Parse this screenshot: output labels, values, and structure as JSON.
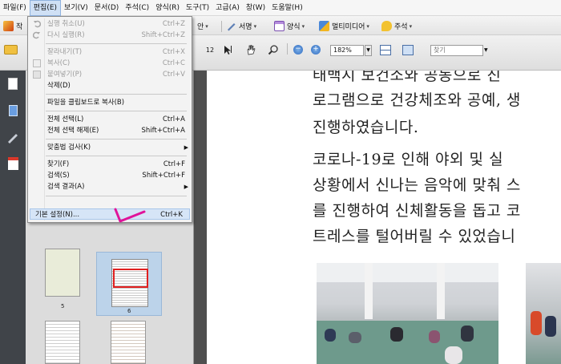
{
  "menubar": [
    "파일(F)",
    "편집(E)",
    "보기(V)",
    "문서(D)",
    "주석(C)",
    "양식(R)",
    "도구(T)",
    "고급(A)",
    "창(W)",
    "도움말(H)"
  ],
  "toolbar1": {
    "partial_left": "작",
    "partial_mid": "안",
    "sign": "서명",
    "form": "양식",
    "multimedia": "멀티미디어",
    "comment": "주석"
  },
  "toolbar2": {
    "partial_num": "12",
    "zoom_value": "182%",
    "find_placeholder": "찾기"
  },
  "edit_menu": [
    {
      "label": "실행 취소(U)",
      "shortcut": "Ctrl+Z",
      "disabled": true
    },
    {
      "label": "다시 실행(R)",
      "shortcut": "Shift+Ctrl+Z",
      "disabled": true
    },
    {
      "label": "잘라내기(T)",
      "shortcut": "Ctrl+X",
      "disabled": true
    },
    {
      "label": "복사(C)",
      "shortcut": "Ctrl+C",
      "disabled": true
    },
    {
      "label": "붙여넣기(P)",
      "shortcut": "Ctrl+V",
      "disabled": true
    },
    {
      "label": "삭제(D)",
      "shortcut": "",
      "disabled": false
    },
    {
      "label": "파일을 클립보드로 복사(B)",
      "shortcut": "",
      "disabled": false
    },
    {
      "label": "전체 선택(L)",
      "shortcut": "Ctrl+A",
      "disabled": false
    },
    {
      "label": "전체 선택 해제(E)",
      "shortcut": "Shift+Ctrl+A",
      "disabled": false
    },
    {
      "label": "맞춤법 검사(K)",
      "shortcut": "",
      "disabled": false,
      "submenu": true
    },
    {
      "label": "찾기(F)",
      "shortcut": "Ctrl+F",
      "disabled": false
    },
    {
      "label": "검색(S)",
      "shortcut": "Shift+Ctrl+F",
      "disabled": false
    },
    {
      "label": "검색 결과(A)",
      "shortcut": "",
      "disabled": false,
      "submenu": true
    },
    {
      "label": "기본 설정(N)...",
      "shortcut": "Ctrl+K",
      "disabled": false,
      "highlighted": true
    }
  ],
  "thumbnails": {
    "page5_label": "5",
    "page6_label": "6"
  },
  "document": {
    "lines": [
      "태백시 보건소와 공동으로 진",
      "로그램으로 건강체조와 공예, 생",
      "진행하였습니다.",
      "  코로나-19로 인해 야외 및 실",
      "상황에서 신나는 음악에 맞춰 스",
      "를 진행하여 신체활동을 돕고 코",
      "트레스를 털어버릴 수 있었습니"
    ]
  },
  "colors": {
    "menu_highlight": "#d6e5f7",
    "annotation_mark": "#e0149a",
    "thumb_selection": "#bcd3ea"
  }
}
